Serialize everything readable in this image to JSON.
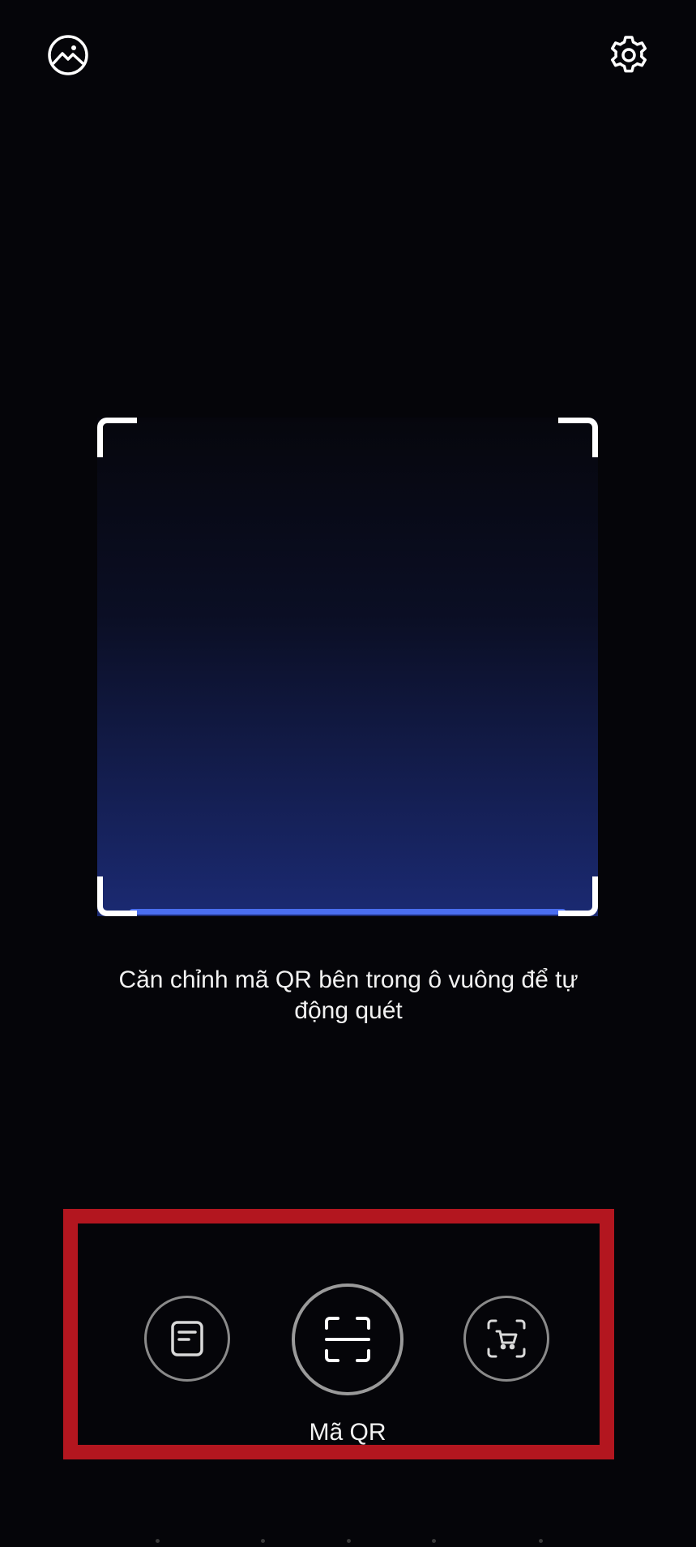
{
  "top_bar": {
    "gallery_icon": "gallery-image-icon",
    "settings_icon": "gear-icon"
  },
  "scanner": {
    "instruction": "Căn chỉnh mã QR bên trong ô vuông để tự động quét",
    "scan_line_color": "#4a6ef0"
  },
  "modes": {
    "items": [
      {
        "name": "document",
        "icon": "document-icon"
      },
      {
        "name": "qr",
        "icon": "qr-scan-icon",
        "label": "Mã QR",
        "selected": true
      },
      {
        "name": "shopping",
        "icon": "shopping-cart-scan-icon"
      }
    ],
    "active_label": "Mã QR",
    "highlight_color": "#b3161f"
  }
}
